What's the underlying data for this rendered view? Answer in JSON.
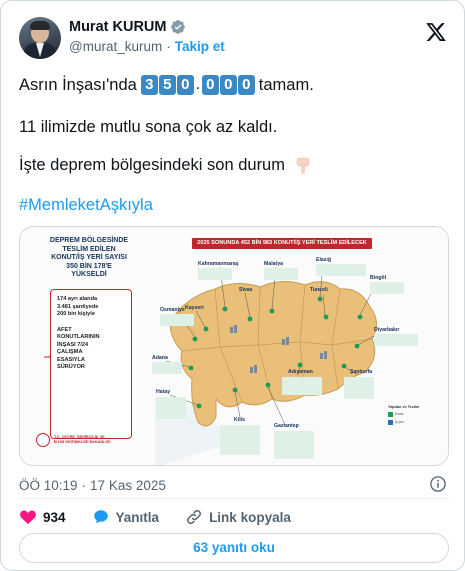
{
  "author": {
    "display_name": "Murat KURUM",
    "handle": "@murat_kurum",
    "separator": "·",
    "follow_label": "Takip et"
  },
  "tweet": {
    "line1_prefix": "Asrın İnşası'nda",
    "number_digits": [
      "3",
      "5",
      "0",
      "0",
      "0",
      "0"
    ],
    "number_separator": ".",
    "line1_suffix": "tamam.",
    "line2": "11 ilimizde mutlu sona çok az kaldı.",
    "line3": "İşte deprem bölgesindeki son durum",
    "hashtag": "#MemleketAşkıyla"
  },
  "infographic": {
    "title_lines": [
      "DEPREM BÖLGESİNDE",
      "TESLİM EDİLEN",
      "KONUT/İŞ YERİ SAYISI",
      "350 BİN 178'E",
      "YÜKSELDİ"
    ],
    "stats": [
      "174 ayrı alanda",
      "3.481 şantiyede",
      "200 bin kişiyle"
    ],
    "work_lines": [
      "AFET",
      "KONUTLARININ",
      "İNŞASI 7/24",
      "ÇALIŞMA",
      "ESASIYLA",
      "SÜRÜYOR"
    ],
    "ministry_lines": [
      "T.C. ÇEVRE, ŞEHİRCİLİK VE",
      "İKLİM DEĞİŞİKLİĞİ BAKANLIĞI"
    ],
    "banner": "2025 SONUNDA 452 BİN 983 KONUT/İŞ YERİ TESLİM EDİLECEK",
    "provinces": [
      "Kahramanmaraş",
      "Malatya",
      "Elazığ",
      "Tunceli",
      "Bingöl",
      "Sivas",
      "Kayseri",
      "Osmaniye",
      "Adana",
      "Diyarbakır",
      "Hatay",
      "Kilis",
      "Adıyaman",
      "Şanlıurfa",
      "Gaziantep"
    ],
    "legend_title": "Yapılan ve Teslim",
    "legend_items": [
      "Konut",
      "İş yeri"
    ]
  },
  "meta": {
    "time": "ÖÖ 10:19",
    "separator": "·",
    "date": "17 Kas 2025"
  },
  "actions": {
    "likes": "934",
    "reply_label": "Yanıtla",
    "copy_link_label": "Link kopyala"
  },
  "replies_button": "63 yanıtı oku",
  "colors": {
    "accent": "#1d9bf0",
    "like": "#f91880",
    "digit_bg": "#3b88c3",
    "map_land": "#e9bf7a",
    "ministry_red": "#c0272d"
  }
}
